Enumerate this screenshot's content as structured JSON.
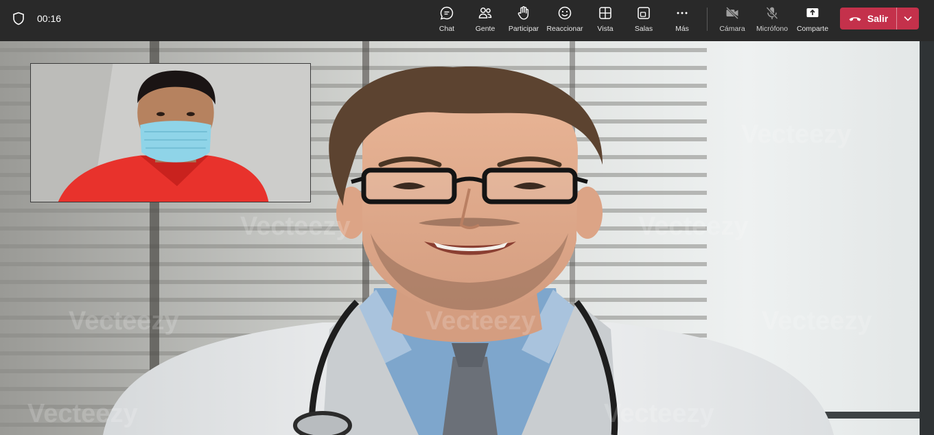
{
  "call": {
    "elapsed": "00:16"
  },
  "toolbar": {
    "chat": "Chat",
    "people": "Gente",
    "raise_hand": "Participar",
    "react": "Reaccionar",
    "view": "Vista",
    "rooms": "Salas",
    "more": "Más",
    "camera": "Cámara",
    "microphone": "Micrófono",
    "share": "Comparte",
    "leave": "Salir"
  },
  "controls_state": {
    "camera": "off",
    "microphone": "off"
  },
  "colors": {
    "topbar": "#292929",
    "leave": "#c4314b"
  },
  "watermark": "Vecteezy",
  "icons": [
    "shield-icon",
    "chat-icon",
    "people-icon",
    "hand-icon",
    "smile-icon",
    "view-icon",
    "rooms-icon",
    "more-icon",
    "camera-off-icon",
    "mic-off-icon",
    "share-icon",
    "phone-icon",
    "chevron-down-icon"
  ]
}
